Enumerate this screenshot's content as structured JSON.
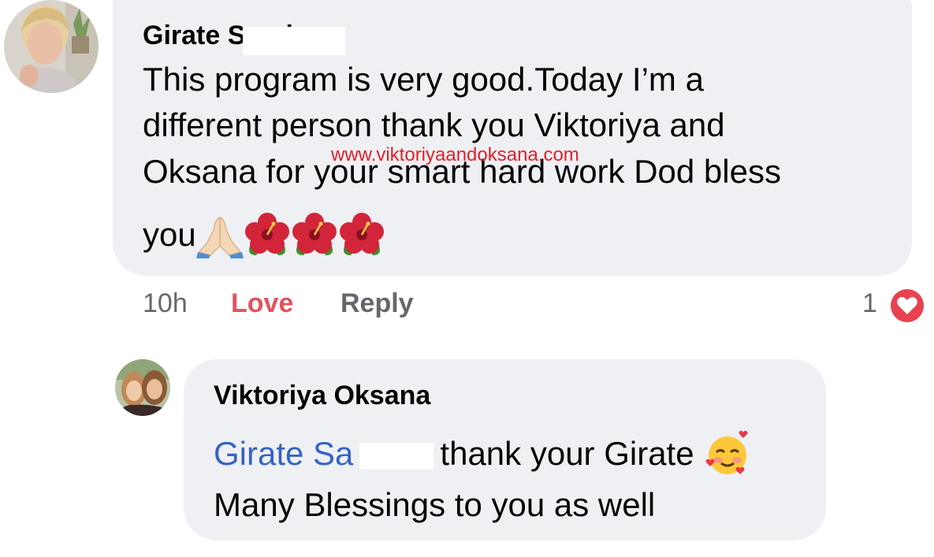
{
  "comment": {
    "author": "Girate Sandu",
    "lines": [
      "This program is very good.Today I’m a",
      "different person thank you Viktoriya  and",
      "Oksana for your smart hard work Dod bless",
      "you"
    ],
    "emojis": [
      "folded-hands",
      "hibiscus",
      "hibiscus",
      "hibiscus"
    ],
    "timestamp": "10h",
    "love_label": "Love",
    "reply_label": "Reply",
    "reaction_count": "1",
    "reaction_type": "heart"
  },
  "watermark": "www.viktoriyaandoksana.com",
  "reply": {
    "author": "Viktoriya Oksana",
    "mention": "Girate Sa",
    "line1_text": "thank your Girate",
    "line1_emoji": "smiling-face-with-hearts",
    "line2": "Many Blessings to you as well"
  },
  "colors": {
    "bubble": "#eff0f3",
    "love": "#e0535f",
    "mention": "#3563c4",
    "meta": "#65676b",
    "watermark": "#e0202a"
  }
}
